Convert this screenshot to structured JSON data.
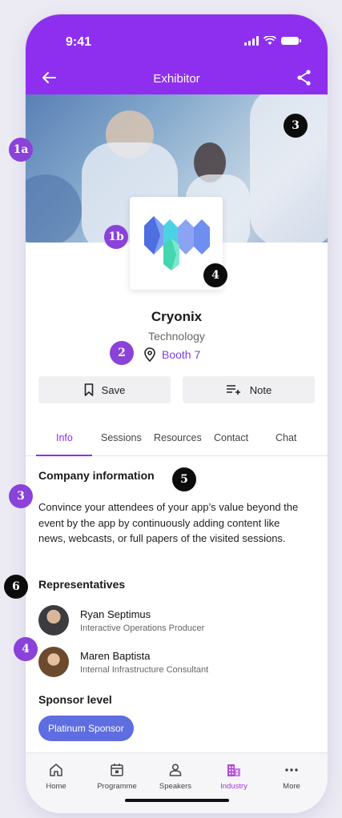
{
  "status": {
    "time": "9:41"
  },
  "header": {
    "title": "Exhibitor"
  },
  "company": {
    "name": "Cryonix",
    "category": "Technology",
    "booth": "Booth 7"
  },
  "actions": {
    "save_label": "Save",
    "note_label": "Note"
  },
  "tabs": [
    {
      "label": "Info",
      "active": true
    },
    {
      "label": "Sessions"
    },
    {
      "label": "Resources"
    },
    {
      "label": "Contact"
    },
    {
      "label": "Chat"
    }
  ],
  "info": {
    "heading": "Company information",
    "text": "Convince your attendees of your app’s value beyond the event by the app by continuously adding content like news, webcasts, or full papers of the visited sessions."
  },
  "representatives": {
    "heading": "Representatives",
    "items": [
      {
        "name": "Ryan Septimus",
        "role": "Interactive Operations Producer"
      },
      {
        "name": "Maren Baptista",
        "role": "Internal Infrastructure Consultant"
      }
    ]
  },
  "sponsor": {
    "heading": "Sponsor level",
    "level": "Platinum Sponsor"
  },
  "bottom_nav": [
    {
      "label": "Home",
      "icon": "home-icon"
    },
    {
      "label": "Programme",
      "icon": "calendar-icon"
    },
    {
      "label": "Speakers",
      "icon": "person-icon"
    },
    {
      "label": "Industry",
      "icon": "building-icon",
      "active": true
    },
    {
      "label": "More",
      "icon": "more-icon"
    }
  ],
  "markers": {
    "m1a": "1a",
    "m1b": "1b",
    "m2": "2",
    "m3_hero": "3",
    "m3_left": "3",
    "m4_logo": "4",
    "m4_left": "4",
    "m5": "5",
    "m6": "6"
  },
  "colors": {
    "brand": "#8e2ff0",
    "accent": "#7b3fe4",
    "sponsor": "#5e6de0"
  }
}
